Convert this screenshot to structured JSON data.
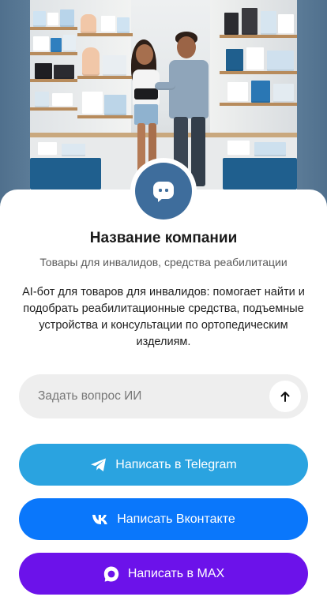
{
  "hero": {
    "image_description_icon": "store-photo"
  },
  "company": {
    "avatar_icon": "chat-bot-icon",
    "name": "Название компании",
    "subtitle": "Товары для инвалидов, средства реабилитации",
    "description": "AI-бот для товаров для инвалидов: помогает найти и подобрать реабилитационные средства, подъемные устройства и консультации по ортопедическим изделиям."
  },
  "ask": {
    "placeholder": "Задать вопрос ИИ",
    "value": "",
    "send_icon": "arrow-up-icon"
  },
  "actions": [
    {
      "label": "Написать в Telegram",
      "icon": "telegram-icon",
      "color": "#2aa3e0"
    },
    {
      "label": "Написать Вконтакте",
      "icon": "vk-icon",
      "color": "#0a77fb"
    },
    {
      "label": "Написать в MAX",
      "icon": "max-icon",
      "color": "#6c12ea"
    }
  ],
  "colors": {
    "avatar": "#3e6d9c",
    "ask_field": "#eeeeee",
    "hero_frame": "#5b7b97"
  }
}
